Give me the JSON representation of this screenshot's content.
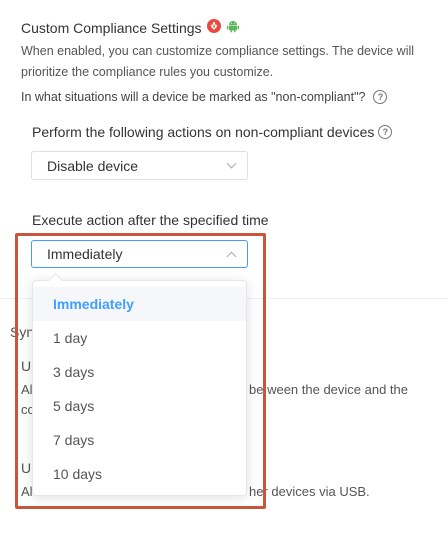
{
  "section": {
    "title": "Custom Compliance Settings",
    "description": "When enabled, you can customize compliance settings. The device will prioritize the compliance rules you customize.",
    "question": "In what situations will a device be marked as \"non-compliant\"?"
  },
  "action_field": {
    "label": "Perform the following actions on non-compliant devices",
    "value": "Disable device"
  },
  "time_field": {
    "label": "Execute action after the specified time",
    "value": "Immediately",
    "options": [
      "Immediately",
      "1 day",
      "3 days",
      "5 days",
      "7 days",
      "10 days"
    ]
  },
  "background": {
    "sync_heading_fragment": "Syn",
    "item1_heading_fragment": "U",
    "item1_line1_prefix": "Al",
    "item1_line1_suffix": "be ween the device and the",
    "item1_line2_prefix": "co",
    "item2_heading_fragment": "U",
    "item2_line_prefix": "Al",
    "item2_line_suffix": "her devices via USB."
  },
  "icons": [
    "huawei-icon",
    "android-icon",
    "help-icon",
    "chevron-down-icon",
    "chevron-up-icon"
  ],
  "colors": {
    "accent": "#409eff",
    "highlight": "#c9553a",
    "huawei": "#e8483d",
    "android": "#5cb85c"
  }
}
